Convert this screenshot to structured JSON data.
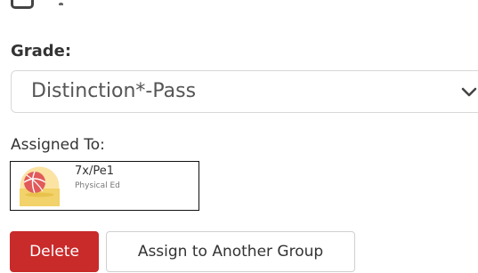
{
  "form": {
    "grade": {
      "label": "Grade:",
      "selected": "Distinction*-Pass"
    },
    "assigned": {
      "label": "Assigned To:",
      "group": {
        "code": "7x/Pe1",
        "subject": "Physical Ed",
        "icon": "basketball-icon"
      }
    }
  },
  "actions": {
    "delete_label": "Delete",
    "assign_label": "Assign to Another Group"
  },
  "colors": {
    "danger": "#c92a2a",
    "border": "#d8d8d8",
    "text": "#333333"
  }
}
